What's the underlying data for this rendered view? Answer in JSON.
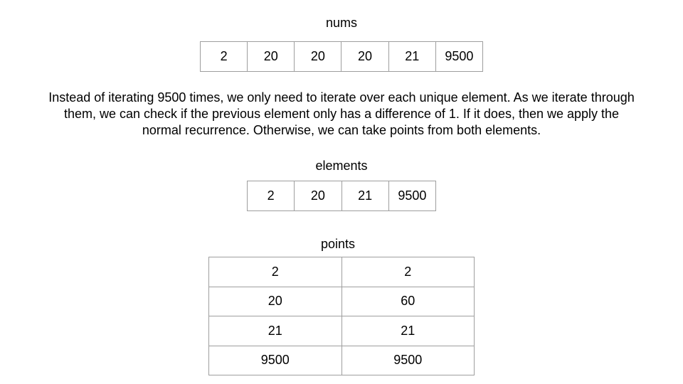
{
  "nums": {
    "label": "nums",
    "values": [
      "2",
      "20",
      "20",
      "20",
      "21",
      "9500"
    ]
  },
  "description": "Instead of iterating 9500 times, we only need to iterate over each unique element. As we iterate through them, we can check if the previous element only has a difference of 1. If it does, then we apply the normal recurrence. Otherwise, we can take points from both elements.",
  "elements": {
    "label": "elements",
    "values": [
      "2",
      "20",
      "21",
      "9500"
    ]
  },
  "points": {
    "label": "points",
    "rows": [
      [
        "2",
        "2"
      ],
      [
        "20",
        "60"
      ],
      [
        "21",
        "21"
      ],
      [
        "9500",
        "9500"
      ]
    ]
  }
}
